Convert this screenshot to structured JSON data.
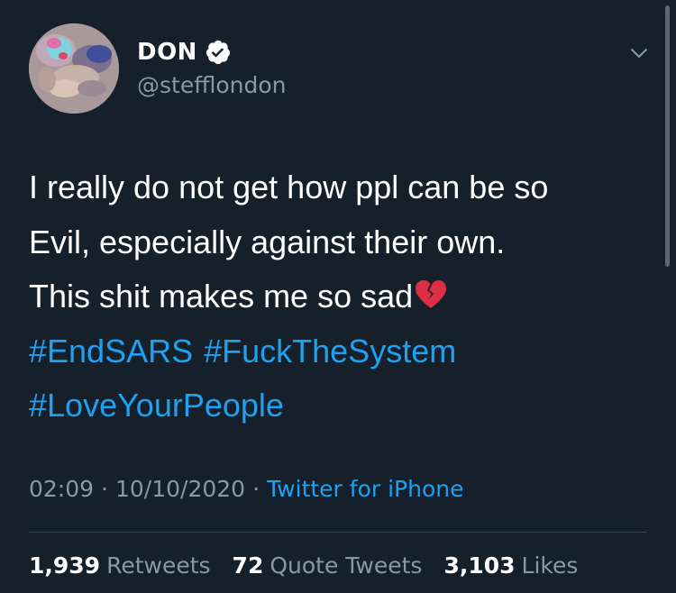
{
  "tweet": {
    "display_name": "DON",
    "handle": "@stefflondon",
    "verified": true,
    "body_lines": [
      "I really do not get how ppl can be so",
      "Evil, especially against their own.",
      "This shit makes me so sad"
    ],
    "emoji": "broken-heart",
    "hashtags": [
      "#EndSARS",
      "#FuckTheSystem",
      "#LoveYourPeople"
    ],
    "time": "02:09",
    "date": "10/10/2020",
    "source": "Twitter for iPhone",
    "stats": {
      "retweets": "1,939",
      "retweets_label": "Retweets",
      "quote_tweets": "72",
      "quote_tweets_label": "Quote Tweets",
      "likes": "3,103",
      "likes_label": "Likes"
    }
  },
  "colors": {
    "background": "#15202b",
    "text": "#ffffff",
    "secondary_text": "#8899a6",
    "link": "#1da1f2",
    "divider": "#38444d"
  }
}
